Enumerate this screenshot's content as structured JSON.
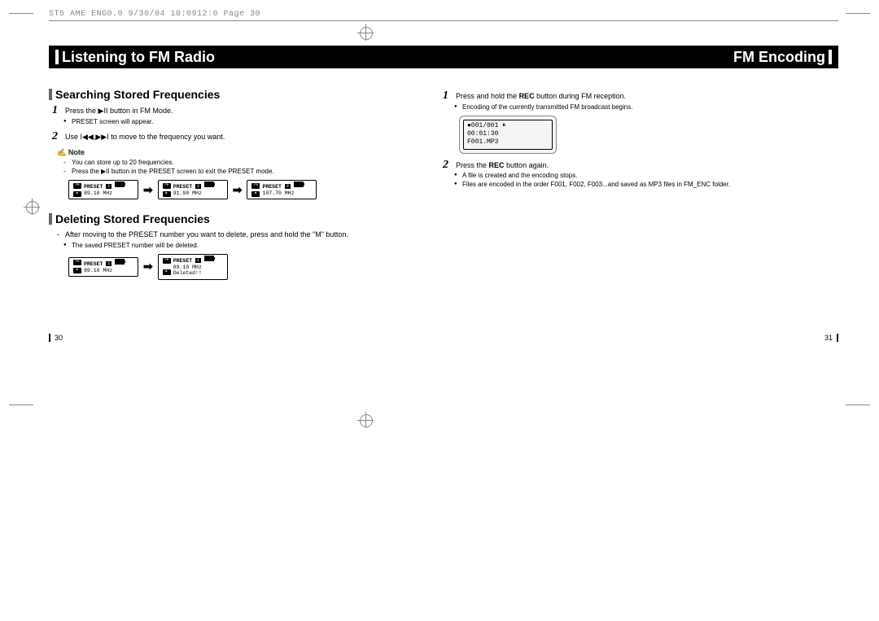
{
  "header_info": "ST5 AME ENG0.0  9/30/04 10:0912:0  Page 30",
  "bar_left": "Listening to FM Radio",
  "bar_right": "FM Encoding",
  "left": {
    "sec1": "Searching Stored Frequencies",
    "s1": "Press the ▶II button in FM Mode.",
    "s1b": "PRESET screen will appear.",
    "s2": "Use I◀◀,▶▶I to move to the frequency you want.",
    "note": "Note",
    "n1": "You can store up to 20 frequencies.",
    "n2": "Press the ▶II button in the PRESET screen to exit the PRESET mode.",
    "lcd1a": "PRESET",
    "lcd1b": "89.10 MHz",
    "lcd2a": "PRESET",
    "lcd2b": "91.90 MHz",
    "lcd3a": "PRESET",
    "lcd3b": "107.70 MHz",
    "sec2": "Deleting Stored Frequencies",
    "d1": "After moving to the PRESET number you want to delete, press and hold the \"M\" button.",
    "d1b": "The saved PRESET number will be deleted.",
    "lcd4a": "PRESET",
    "lcd4b": "89.10 MHz",
    "lcd5a": "PRESET",
    "lcd5b": "89.10 MHz",
    "lcd5c": "Deleted!!"
  },
  "right": {
    "r1": "Press and hold the REC button during FM reception.",
    "r1b": "Encoding of the currently transmitted FM broadcast begins.",
    "lcdr1": "●001/001  ⏸",
    "lcdr2": "  00:01:30",
    "lcdr3": "F001.MP3",
    "r2": "Press the REC button again.",
    "r2b": "A file is created and the encoding stops.",
    "r2c": "Files are encoded in the order F001, F002, F003...and saved as MP3 files in FM_ENC folder."
  },
  "page_left": "30",
  "page_right": "31"
}
